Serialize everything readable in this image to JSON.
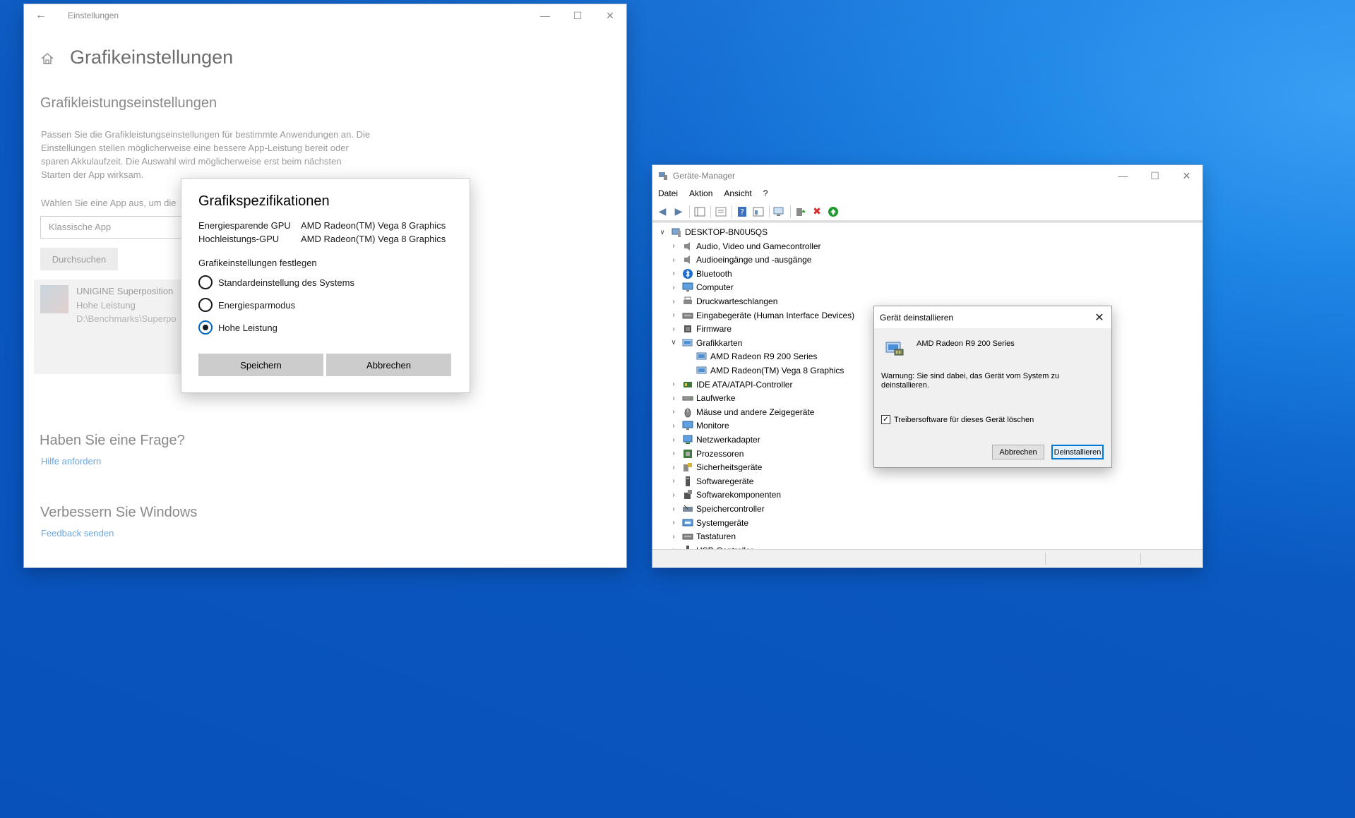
{
  "settings": {
    "window_title": "Einstellungen",
    "page_title": "Grafikeinstellungen",
    "section_title": "Grafikleistungseinstellungen",
    "description": "Passen Sie die Grafikleistungseinstellungen für bestimmte Anwendungen an. Die Einstellungen stellen möglicherweise eine bessere App-Leistung bereit oder sparen Akkulaufzeit. Die Auswahl wird möglicherweise erst beim nächsten Starten der App wirksam.",
    "choose_app_label": "Wählen Sie eine App aus, um die",
    "app_type_select": "Klassische App",
    "browse_button": "Durchsuchen",
    "app_entry": {
      "name": "UNIGINE Superposition",
      "mode": "Hohe Leistung",
      "path": "D:\\Benchmarks\\Superpo"
    },
    "question_heading": "Haben Sie eine Frage?",
    "help_link": "Hilfe anfordern",
    "improve_heading": "Verbessern Sie Windows",
    "feedback_link": "Feedback senden"
  },
  "gfx_dialog": {
    "title": "Grafikspezifikationen",
    "power_saving_label": "Energiesparende GPU",
    "power_saving_value": "AMD Radeon(TM) Vega 8 Graphics",
    "high_perf_label": "Hochleistungs-GPU",
    "high_perf_value": "AMD Radeon(TM) Vega 8 Graphics",
    "set_label": "Grafikeinstellungen festlegen",
    "options": [
      {
        "label": "Standardeinstellung des Systems",
        "selected": false
      },
      {
        "label": "Energiesparmodus",
        "selected": false
      },
      {
        "label": "Hohe Leistung",
        "selected": true
      }
    ],
    "save_button": "Speichern",
    "cancel_button": "Abbrechen"
  },
  "device_manager": {
    "window_title": "Geräte-Manager",
    "menu": [
      "Datei",
      "Aktion",
      "Ansicht",
      "?"
    ],
    "root": "DESKTOP-BN0U5QS",
    "categories": [
      {
        "label": "Audio, Video und Gamecontroller",
        "icon": "speaker-icon",
        "expanded": false
      },
      {
        "label": "Audioeingänge und -ausgänge",
        "icon": "speaker-icon",
        "expanded": false
      },
      {
        "label": "Bluetooth",
        "icon": "bluetooth-icon",
        "expanded": false
      },
      {
        "label": "Computer",
        "icon": "monitor-icon",
        "expanded": false
      },
      {
        "label": "Druckwarteschlangen",
        "icon": "printer-icon",
        "expanded": false
      },
      {
        "label": "Eingabegeräte (Human Interface Devices)",
        "icon": "keyboard-icon",
        "expanded": false
      },
      {
        "label": "Firmware",
        "icon": "chip-icon",
        "expanded": false
      },
      {
        "label": "Grafikkarten",
        "icon": "display-adapter-icon",
        "expanded": true,
        "children": [
          "AMD Radeon R9 200 Series",
          "AMD Radeon(TM) Vega 8 Graphics"
        ]
      },
      {
        "label": "IDE ATA/ATAPI-Controller",
        "icon": "controller-icon",
        "expanded": false
      },
      {
        "label": "Laufwerke",
        "icon": "drive-icon",
        "expanded": false
      },
      {
        "label": "Mäuse und andere Zeigegeräte",
        "icon": "mouse-icon",
        "expanded": false
      },
      {
        "label": "Monitore",
        "icon": "monitor-icon",
        "expanded": false
      },
      {
        "label": "Netzwerkadapter",
        "icon": "network-icon",
        "expanded": false
      },
      {
        "label": "Prozessoren",
        "icon": "cpu-icon",
        "expanded": false
      },
      {
        "label": "Sicherheitsgeräte",
        "icon": "security-icon",
        "expanded": false
      },
      {
        "label": "Softwaregeräte",
        "icon": "software-device-icon",
        "expanded": false
      },
      {
        "label": "Softwarekomponenten",
        "icon": "software-component-icon",
        "expanded": false
      },
      {
        "label": "Speichercontroller",
        "icon": "storage-icon",
        "expanded": false
      },
      {
        "label": "Systemgeräte",
        "icon": "system-icon",
        "expanded": false
      },
      {
        "label": "Tastaturen",
        "icon": "keyboard-icon",
        "expanded": false
      },
      {
        "label": "USB-Controller",
        "icon": "usb-icon",
        "expanded": false
      }
    ]
  },
  "uninstall_dialog": {
    "title": "Gerät deinstallieren",
    "device_name": "AMD Radeon R9 200 Series",
    "warning": "Warnung: Sie sind dabei, das Gerät vom System zu deinstallieren.",
    "delete_driver_label": "Treibersoftware für dieses Gerät löschen",
    "delete_driver_checked": true,
    "cancel_button": "Abbrechen",
    "uninstall_button": "Deinstallieren"
  },
  "colors": {
    "desktop_blue": "#0b6fd6",
    "accent": "#0078d7",
    "link": "#6aa7e0",
    "delete_red": "#d62a2a",
    "update_green": "#1a9a2a"
  }
}
